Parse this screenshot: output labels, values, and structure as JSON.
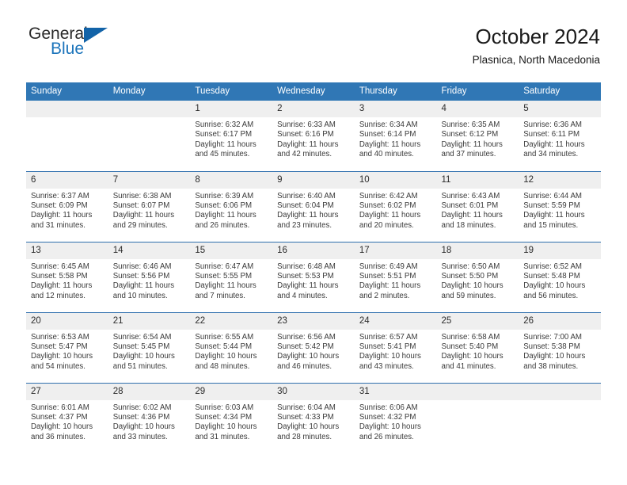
{
  "brand": {
    "name_part1": "General",
    "name_part2": "Blue",
    "triangle_icon": "triangle-icon",
    "accent_color": "#1263a8"
  },
  "header": {
    "title": "October 2024",
    "subtitle": "Plasnica, North Macedonia"
  },
  "theme": {
    "header_blue": "#3077b5",
    "row_border_blue": "#2f6fad",
    "daynum_band": "#efefef",
    "text": "#3a3a3a"
  },
  "calendar": {
    "columns": [
      "Sunday",
      "Monday",
      "Tuesday",
      "Wednesday",
      "Thursday",
      "Friday",
      "Saturday"
    ],
    "labels": {
      "sunrise": "Sunrise:",
      "sunset": "Sunset:",
      "daylight": "Daylight:"
    },
    "weeks": [
      [
        {
          "day": ""
        },
        {
          "day": ""
        },
        {
          "day": "1",
          "sunrise": "Sunrise: 6:32 AM",
          "sunset": "Sunset: 6:17 PM",
          "daylight": "Daylight: 11 hours and 45 minutes."
        },
        {
          "day": "2",
          "sunrise": "Sunrise: 6:33 AM",
          "sunset": "Sunset: 6:16 PM",
          "daylight": "Daylight: 11 hours and 42 minutes."
        },
        {
          "day": "3",
          "sunrise": "Sunrise: 6:34 AM",
          "sunset": "Sunset: 6:14 PM",
          "daylight": "Daylight: 11 hours and 40 minutes."
        },
        {
          "day": "4",
          "sunrise": "Sunrise: 6:35 AM",
          "sunset": "Sunset: 6:12 PM",
          "daylight": "Daylight: 11 hours and 37 minutes."
        },
        {
          "day": "5",
          "sunrise": "Sunrise: 6:36 AM",
          "sunset": "Sunset: 6:11 PM",
          "daylight": "Daylight: 11 hours and 34 minutes."
        }
      ],
      [
        {
          "day": "6",
          "sunrise": "Sunrise: 6:37 AM",
          "sunset": "Sunset: 6:09 PM",
          "daylight": "Daylight: 11 hours and 31 minutes."
        },
        {
          "day": "7",
          "sunrise": "Sunrise: 6:38 AM",
          "sunset": "Sunset: 6:07 PM",
          "daylight": "Daylight: 11 hours and 29 minutes."
        },
        {
          "day": "8",
          "sunrise": "Sunrise: 6:39 AM",
          "sunset": "Sunset: 6:06 PM",
          "daylight": "Daylight: 11 hours and 26 minutes."
        },
        {
          "day": "9",
          "sunrise": "Sunrise: 6:40 AM",
          "sunset": "Sunset: 6:04 PM",
          "daylight": "Daylight: 11 hours and 23 minutes."
        },
        {
          "day": "10",
          "sunrise": "Sunrise: 6:42 AM",
          "sunset": "Sunset: 6:02 PM",
          "daylight": "Daylight: 11 hours and 20 minutes."
        },
        {
          "day": "11",
          "sunrise": "Sunrise: 6:43 AM",
          "sunset": "Sunset: 6:01 PM",
          "daylight": "Daylight: 11 hours and 18 minutes."
        },
        {
          "day": "12",
          "sunrise": "Sunrise: 6:44 AM",
          "sunset": "Sunset: 5:59 PM",
          "daylight": "Daylight: 11 hours and 15 minutes."
        }
      ],
      [
        {
          "day": "13",
          "sunrise": "Sunrise: 6:45 AM",
          "sunset": "Sunset: 5:58 PM",
          "daylight": "Daylight: 11 hours and 12 minutes."
        },
        {
          "day": "14",
          "sunrise": "Sunrise: 6:46 AM",
          "sunset": "Sunset: 5:56 PM",
          "daylight": "Daylight: 11 hours and 10 minutes."
        },
        {
          "day": "15",
          "sunrise": "Sunrise: 6:47 AM",
          "sunset": "Sunset: 5:55 PM",
          "daylight": "Daylight: 11 hours and 7 minutes."
        },
        {
          "day": "16",
          "sunrise": "Sunrise: 6:48 AM",
          "sunset": "Sunset: 5:53 PM",
          "daylight": "Daylight: 11 hours and 4 minutes."
        },
        {
          "day": "17",
          "sunrise": "Sunrise: 6:49 AM",
          "sunset": "Sunset: 5:51 PM",
          "daylight": "Daylight: 11 hours and 2 minutes."
        },
        {
          "day": "18",
          "sunrise": "Sunrise: 6:50 AM",
          "sunset": "Sunset: 5:50 PM",
          "daylight": "Daylight: 10 hours and 59 minutes."
        },
        {
          "day": "19",
          "sunrise": "Sunrise: 6:52 AM",
          "sunset": "Sunset: 5:48 PM",
          "daylight": "Daylight: 10 hours and 56 minutes."
        }
      ],
      [
        {
          "day": "20",
          "sunrise": "Sunrise: 6:53 AM",
          "sunset": "Sunset: 5:47 PM",
          "daylight": "Daylight: 10 hours and 54 minutes."
        },
        {
          "day": "21",
          "sunrise": "Sunrise: 6:54 AM",
          "sunset": "Sunset: 5:45 PM",
          "daylight": "Daylight: 10 hours and 51 minutes."
        },
        {
          "day": "22",
          "sunrise": "Sunrise: 6:55 AM",
          "sunset": "Sunset: 5:44 PM",
          "daylight": "Daylight: 10 hours and 48 minutes."
        },
        {
          "day": "23",
          "sunrise": "Sunrise: 6:56 AM",
          "sunset": "Sunset: 5:42 PM",
          "daylight": "Daylight: 10 hours and 46 minutes."
        },
        {
          "day": "24",
          "sunrise": "Sunrise: 6:57 AM",
          "sunset": "Sunset: 5:41 PM",
          "daylight": "Daylight: 10 hours and 43 minutes."
        },
        {
          "day": "25",
          "sunrise": "Sunrise: 6:58 AM",
          "sunset": "Sunset: 5:40 PM",
          "daylight": "Daylight: 10 hours and 41 minutes."
        },
        {
          "day": "26",
          "sunrise": "Sunrise: 7:00 AM",
          "sunset": "Sunset: 5:38 PM",
          "daylight": "Daylight: 10 hours and 38 minutes."
        }
      ],
      [
        {
          "day": "27",
          "sunrise": "Sunrise: 6:01 AM",
          "sunset": "Sunset: 4:37 PM",
          "daylight": "Daylight: 10 hours and 36 minutes."
        },
        {
          "day": "28",
          "sunrise": "Sunrise: 6:02 AM",
          "sunset": "Sunset: 4:36 PM",
          "daylight": "Daylight: 10 hours and 33 minutes."
        },
        {
          "day": "29",
          "sunrise": "Sunrise: 6:03 AM",
          "sunset": "Sunset: 4:34 PM",
          "daylight": "Daylight: 10 hours and 31 minutes."
        },
        {
          "day": "30",
          "sunrise": "Sunrise: 6:04 AM",
          "sunset": "Sunset: 4:33 PM",
          "daylight": "Daylight: 10 hours and 28 minutes."
        },
        {
          "day": "31",
          "sunrise": "Sunrise: 6:06 AM",
          "sunset": "Sunset: 4:32 PM",
          "daylight": "Daylight: 10 hours and 26 minutes."
        },
        {
          "day": ""
        },
        {
          "day": ""
        }
      ]
    ]
  }
}
